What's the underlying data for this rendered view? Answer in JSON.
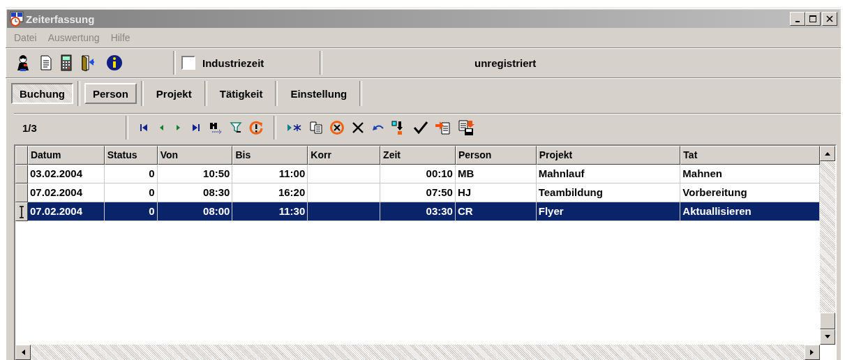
{
  "window": {
    "title": "Zeiterfassung"
  },
  "menu": [
    {
      "label": "Datei"
    },
    {
      "label": "Auswertung"
    },
    {
      "label": "Hilfe"
    }
  ],
  "toolbar": {
    "checkbox": {
      "label": "Industriezeit",
      "checked": false
    },
    "status": "unregistriert"
  },
  "tabs": [
    {
      "label": "Buchung",
      "selected": true,
      "hover": false
    },
    {
      "label": "Person",
      "selected": false,
      "hover": true
    },
    {
      "label": "Projekt",
      "selected": false,
      "hover": false
    },
    {
      "label": "Tätigkeit",
      "selected": false,
      "hover": false
    },
    {
      "label": "Einstellung",
      "selected": false,
      "hover": false
    }
  ],
  "navigator": {
    "record": "1/3"
  },
  "table": {
    "columns": [
      "Datum",
      "Status",
      "Von",
      "Bis",
      "Korr",
      "Zeit",
      "Person",
      "Projekt",
      "Tat"
    ],
    "rows": [
      {
        "cells": [
          "03.02.2004",
          "0",
          "10:50",
          "11:00",
          "",
          "00:10",
          "MB",
          "Mahnlauf",
          "Mahnen"
        ],
        "selected": false
      },
      {
        "cells": [
          "07.02.2004",
          "0",
          "08:30",
          "16:20",
          "",
          "07:50",
          "HJ",
          "Teambildung",
          "Vorbereitung"
        ],
        "selected": false
      },
      {
        "cells": [
          "07.02.2004",
          "0",
          "08:00",
          "11:30",
          "",
          "03:30",
          "CR",
          "Flyer",
          "Aktuallisieren"
        ],
        "selected": true
      }
    ]
  }
}
